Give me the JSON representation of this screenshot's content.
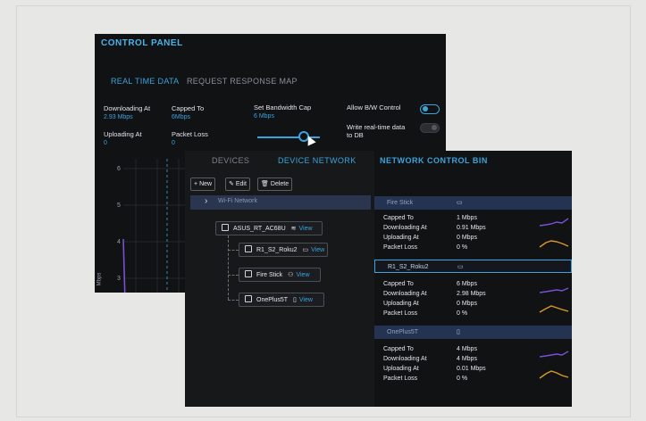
{
  "control_panel": {
    "title": "CONTROL PANEL",
    "tabs": [
      "REAL TIME DATA",
      "REQUEST RESPONSE MAP"
    ],
    "downloading_label": "Downloading At",
    "downloading_value": "2.93 Mbps",
    "capped_label": "Capped To",
    "capped_value": "6Mbps",
    "uploading_label": "Uploading At",
    "uploading_value": "0",
    "packet_loss_label": "Packet Loss",
    "packet_loss_value": "0",
    "bandwidth_cap_label": "Set Bandwidth Cap",
    "bandwidth_cap_value": "6 Mbps",
    "allow_bw_label": "Allow B/W Control",
    "write_rt_label": "Write real-time data to DB",
    "allow_bw_on": true,
    "write_rt_on": false,
    "chart": {
      "y_ticks": [
        "6",
        "5",
        "4",
        "3"
      ],
      "y_label": "Mbps"
    }
  },
  "device_network": {
    "tabs": [
      "DEVICES",
      "DEVICE NETWORK"
    ],
    "toolbar": {
      "new_label": "New",
      "edit_label": "Edit",
      "delete_label": "Delete"
    },
    "network_label": "Wi-Fi Network",
    "router": {
      "name": "ASUS_RT_AC68U",
      "icon": "wifi-icon",
      "view": "View"
    },
    "devices": [
      {
        "name": "R1_S2_Roku2",
        "icon": "tv-icon",
        "view": "View"
      },
      {
        "name": "Fire Stick",
        "icon": "network-icon",
        "view": "View"
      },
      {
        "name": "OnePlus5T",
        "icon": "phone-icon",
        "view": "View"
      }
    ]
  },
  "network_control_bin": {
    "title": "NETWORK CONTROL BIN",
    "labels": {
      "capped": "Capped To",
      "downloading": "Downloading At",
      "uploading": "Uploading At",
      "packet_loss": "Packet Loss"
    },
    "devices": [
      {
        "name": "Fire Stick",
        "icon": "tv-icon",
        "capped": "1 Mbps",
        "downloading": "0.91 Mbps",
        "uploading": "0 Mbps",
        "packet_loss": "0 %"
      },
      {
        "name": "R1_S2_Roku2",
        "icon": "tv-icon",
        "capped": "6 Mbps",
        "downloading": "2.98 Mbps",
        "uploading": "0 Mbps",
        "packet_loss": "0 %"
      },
      {
        "name": "OnePlus5T",
        "icon": "phone-icon",
        "capped": "4 Mbps",
        "downloading": "4 Mbps",
        "uploading": "0.01 Mbps",
        "packet_loss": "0 %"
      }
    ],
    "spark_colors": {
      "download": "#7b4fd6",
      "upload": "#d99a2b"
    }
  },
  "colors": {
    "accent": "#3aa4dd",
    "panel_bg": "#111214",
    "row_header": "#253352"
  }
}
